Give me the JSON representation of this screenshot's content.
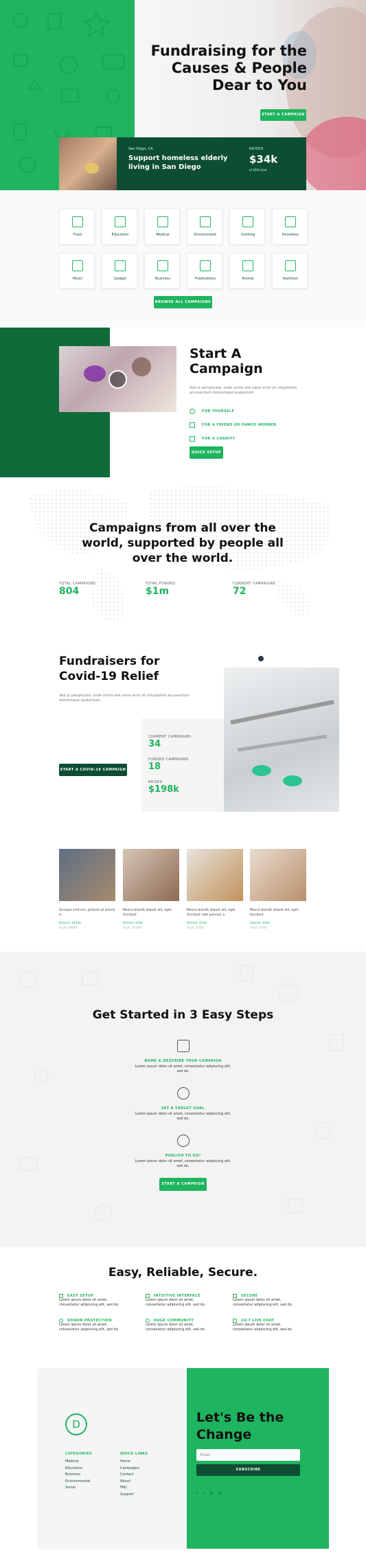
{
  "hero": {
    "title_l1": "Fundraising for the",
    "title_l2": "Causes & People",
    "title_l3": "Dear to You",
    "cta": "START A CAMPAIGN",
    "featured": {
      "location": "San Diego, CA",
      "title_l1": "Support homeless elderly",
      "title_l2": "living in San Diego",
      "raised_label": "RAISED",
      "raised": "$34k",
      "goal": "of $50k Goal"
    }
  },
  "categories": {
    "items": [
      "Food",
      "Education",
      "Medical",
      "Environment",
      "Clothing",
      "Homeless",
      "Music",
      "Gadget",
      "Business",
      "Publications",
      "Animal",
      "Nutrition"
    ],
    "button": "BROWSE ALL CAMPAIGNS"
  },
  "start": {
    "title_l1": "Start A",
    "title_l2": "Campaign",
    "desc": "Sed ut perspiciatis, unde omnis iste natus error sit voluptatem accusantium doloremque laudantium.",
    "options": [
      "FOR YOURSELF",
      "FOR A FRIEND OR FAMILY MEMBER",
      "FOR A CHARITY"
    ],
    "button": "QUICK SETUP"
  },
  "world": {
    "title_l1": "Campaigns from all over the",
    "title_l2": "world, supported by people all",
    "title_l3": "over the world.",
    "stats": [
      {
        "label": "TOTAL CAMPAIGNS",
        "value": "804"
      },
      {
        "label": "TOTAL FUNDED",
        "value": "$1m"
      },
      {
        "label": "CURRENT CAMPAIGNS",
        "value": "72"
      }
    ]
  },
  "covid": {
    "title_l1": "Fundraisers for",
    "title_l2": "Covid-19 Relief",
    "desc": "Sed ut perspiciatis, unde omnis iste natus error sit voluptatem accusantium doloremque laudantium.",
    "button": "START A COVID-19 CAMPAIGN",
    "stats": [
      {
        "label": "CURRENT CAMPAIGNS",
        "value": "34"
      },
      {
        "label": "FUNDED CAMPAIGNS",
        "value": "18"
      },
      {
        "label": "RAISED",
        "value": "$198k"
      }
    ]
  },
  "campaigns": [
    {
      "title": "Quisque velit nisi, pretium ut lacinia in",
      "raised": "Raised: $534k",
      "goal": "Goal: $800k"
    },
    {
      "title": "Mauris blandit aliquet elit, eget tincidunt",
      "raised": "Raised: $50k",
      "goal": "Goal: $150k"
    },
    {
      "title": "Mauris blandit aliquet elit, eget tincidunt nibh pulvinar a",
      "raised": "Raised: $12k",
      "goal": "Goal: $20k"
    },
    {
      "title": "Mauris blandit aliquet elit, eget tincidunt",
      "raised": "Raised: $24k",
      "goal": "Goal: $50k"
    }
  ],
  "steps": {
    "title": "Get Started in 3 Easy Steps",
    "items": [
      {
        "label": "NAME & DESCRIBE YOUR CAMPAIGN",
        "text_l1": "Lorem ipsum dolor sit amet, consectetur adipiscing elit,",
        "text_l2": "sed do."
      },
      {
        "label": "SET A TARGET GOAL",
        "text_l1": "Lorem ipsum dolor sit amet, consectetur adipiscing elit,",
        "text_l2": "sed do."
      },
      {
        "label": "PUBLISH TO GO!",
        "text_l1": "Lorem ipsum dolor sit amet, consectetur adipiscing elit,",
        "text_l2": "sed do."
      }
    ],
    "button": "START A CAMPAIGN"
  },
  "features": {
    "title": "Easy, Reliable, Secure.",
    "items": [
      {
        "label": "EASY SETUP",
        "text_l1": "Lorem ipsum dolor sit amet,",
        "text_l2": "consectetur adipiscing elit, sed do."
      },
      {
        "label": "INTUITIVE INTERFACE",
        "text_l1": "Lorem ipsum dolor sit amet,",
        "text_l2": "consectetur adipiscing elit, sed do."
      },
      {
        "label": "SECURE",
        "text_l1": "Lorem ipsum dolor sit amet,",
        "text_l2": "consectetur adipiscing elit, sed do."
      },
      {
        "label": "DONOR PROTECTION",
        "text_l1": "Lorem ipsum dolor sit amet,",
        "text_l2": "consectetur adipiscing elit, sed do."
      },
      {
        "label": "HUGE COMMUNITY",
        "text_l1": "Lorem ipsum dolor sit amet,",
        "text_l2": "consectetur adipiscing elit, sed do."
      },
      {
        "label": "24/7 LIVE CHAT",
        "text_l1": "Lorem ipsum dolor sit amet,",
        "text_l2": "consectetur adipiscing elit, sed do."
      }
    ]
  },
  "footer": {
    "logo": "D",
    "categories_title": "CATEGORIES",
    "categories": [
      "Medical",
      "Education",
      "Business",
      "Environmental",
      "Social"
    ],
    "links_title": "QUICK LINKS",
    "links": [
      "Home",
      "Campaigns",
      "Contact",
      "About",
      "FAQ",
      "Support"
    ],
    "cta_l1": "Let's Be the",
    "cta_l2": "Change",
    "email_placeholder": "Email",
    "subscribe": "SUBSCRIBE",
    "social": [
      "f",
      "t",
      "in",
      "yt"
    ]
  }
}
